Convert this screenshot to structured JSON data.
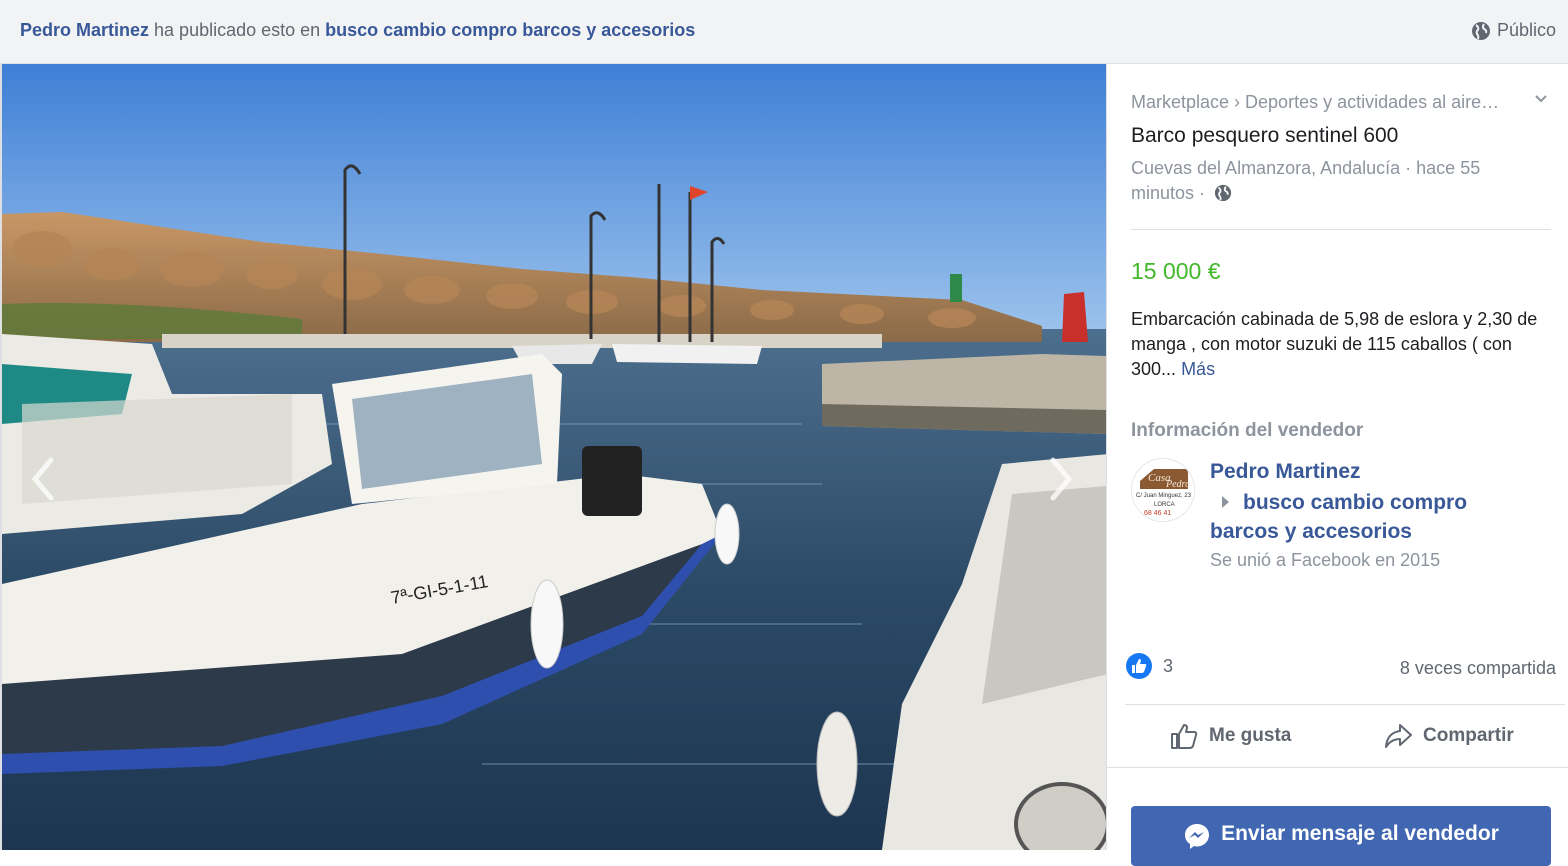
{
  "header": {
    "author": "Pedro Martinez",
    "posted_text": " ha publicado esto en ",
    "group": "busco cambio compro barcos y accesorios",
    "privacy": "Público",
    "privacy_icon": "globe-icon"
  },
  "listing": {
    "breadcrumb": "Marketplace › Deportes y actividades al aire…",
    "title": "Barco pesquero sentinel 600",
    "location_time": "Cuevas del Almanzora, Andalucía · hace 55 minutos ·",
    "price": "15 000 €",
    "description": "Embarcación cabinada de 5,98 de eslora y 2,30 de manga , con motor suzuki de 115 caballos ( con 300...",
    "more_label": "Más",
    "boat_registration": "7ª-GI-5-1-11"
  },
  "seller": {
    "heading": "Información del vendedor",
    "name": "Pedro Martinez",
    "group": "busco cambio compro barcos y accesorios",
    "joined": "Se unió a Facebook en 2015",
    "avatar_lines": [
      "Casa",
      "Pedro",
      "C/ Juan Minguez, 23",
      "LORCA",
      "68 46 41"
    ]
  },
  "engagement": {
    "likes": "3",
    "shares": "8 veces compartida",
    "like_label": "Me gusta",
    "share_label": "Compartir",
    "message_label": "Enviar mensaje al vendedor"
  },
  "colors": {
    "link": "#385898",
    "price": "#42b72a",
    "button": "#4267b2",
    "muted": "#8d949e"
  }
}
